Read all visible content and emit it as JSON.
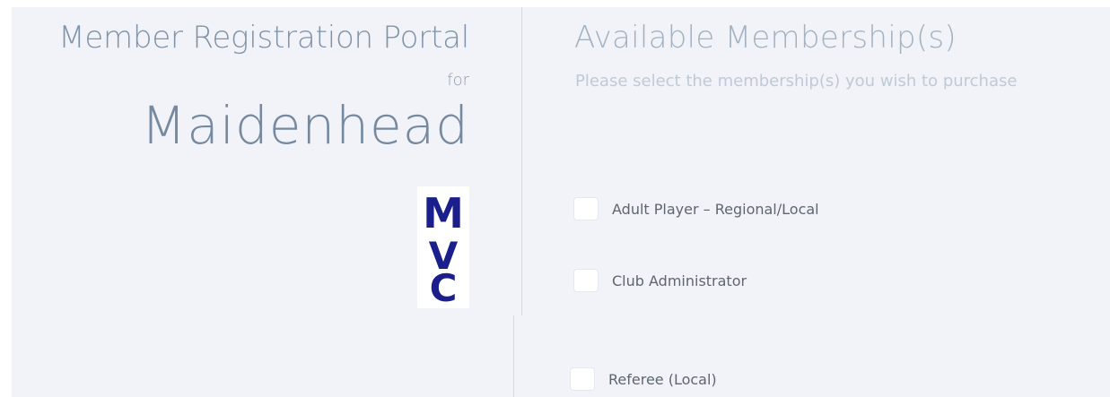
{
  "portal": {
    "title": "Member Registration Portal",
    "for_text": "for",
    "club_name": "Maidenhead",
    "logo_letters": [
      "M",
      "V",
      "C"
    ]
  },
  "memberships": {
    "title": "Available Membership(s)",
    "subtitle": "Please select the membership(s) you wish to purchase",
    "options": [
      {
        "label": "Adult Player – Regional/Local",
        "checked": false
      },
      {
        "label": "Club Administrator",
        "checked": false
      },
      {
        "label": "Referee (Local)",
        "checked": false
      }
    ]
  },
  "colors": {
    "panel_background": "#f1f3f8",
    "logo_blue": "#1a1f8c",
    "title_gray": "#7f93aa"
  },
  "icons": {
    "logo": "club-logo-mvc"
  }
}
